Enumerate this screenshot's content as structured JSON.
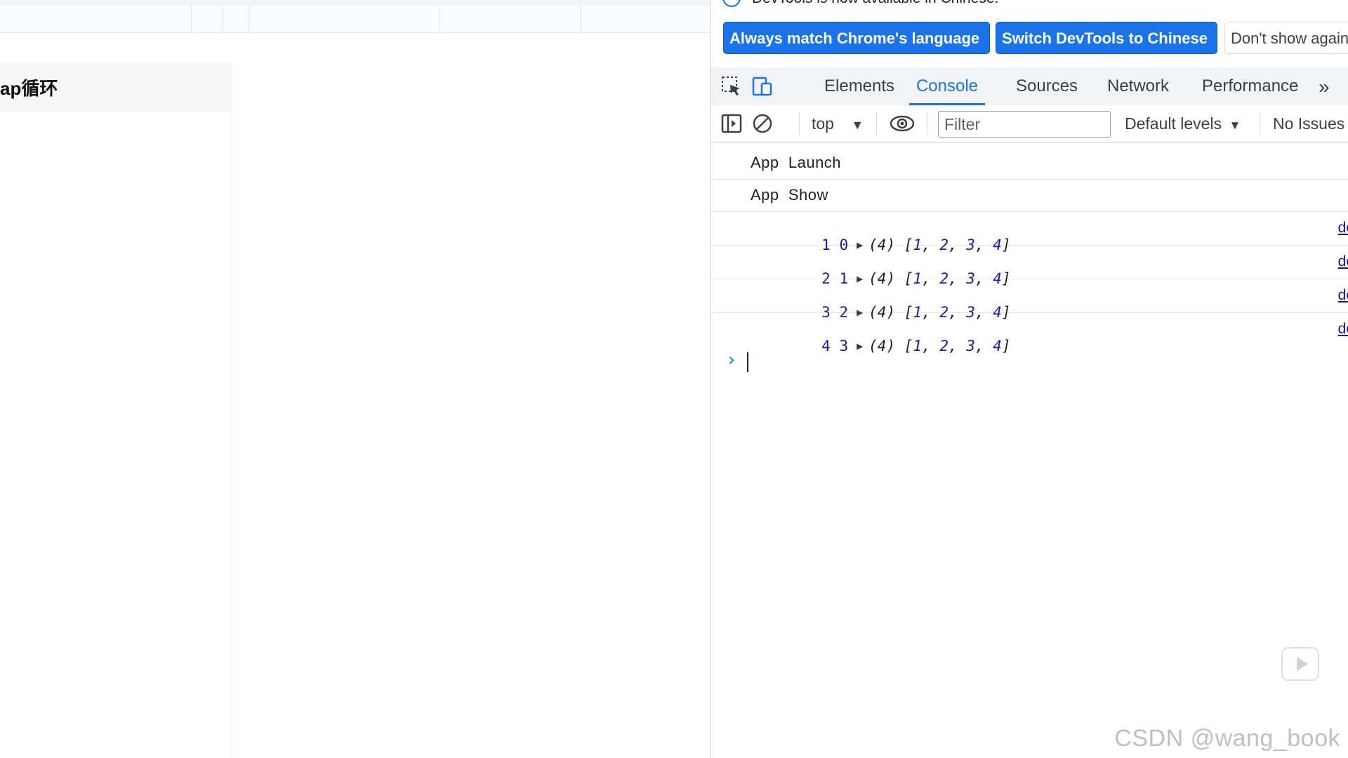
{
  "simulator": {
    "nav_title": "ap循环"
  },
  "infobar": {
    "message": "DevTools is now available in Chinese!",
    "btn_match": "Always match Chrome's language",
    "btn_switch": "Switch DevTools to Chinese",
    "btn_dont": "Don't show again"
  },
  "devtools": {
    "tabs": [
      "Elements",
      "Console",
      "Sources",
      "Network",
      "Performance"
    ],
    "active_tab": "Console",
    "more_tabs": "»"
  },
  "console_toolbar": {
    "context": "top",
    "filter_placeholder": "Filter",
    "levels": "Default levels",
    "issues": "No Issues"
  },
  "console": {
    "messages": [
      {
        "text": "App  Launch"
      },
      {
        "text": "App  Show"
      },
      {
        "a": "1",
        "b": "0",
        "len": "(4)",
        "arr": [
          "1",
          "2",
          "3",
          "4"
        ],
        "src": "de"
      },
      {
        "a": "2",
        "b": "1",
        "len": "(4)",
        "arr": [
          "1",
          "2",
          "3",
          "4"
        ],
        "src": "de"
      },
      {
        "a": "3",
        "b": "2",
        "len": "(4)",
        "arr": [
          "1",
          "2",
          "3",
          "4"
        ],
        "src": "de"
      },
      {
        "a": "4",
        "b": "3",
        "len": "(4)",
        "arr": [
          "1",
          "2",
          "3",
          "4"
        ],
        "src": "de"
      }
    ],
    "prompt": "›"
  },
  "watermark": "CSDN @wang_book",
  "colors": {
    "accent": "#1a73e8",
    "number": "#1a1aa6",
    "link": "#1a0dab"
  }
}
